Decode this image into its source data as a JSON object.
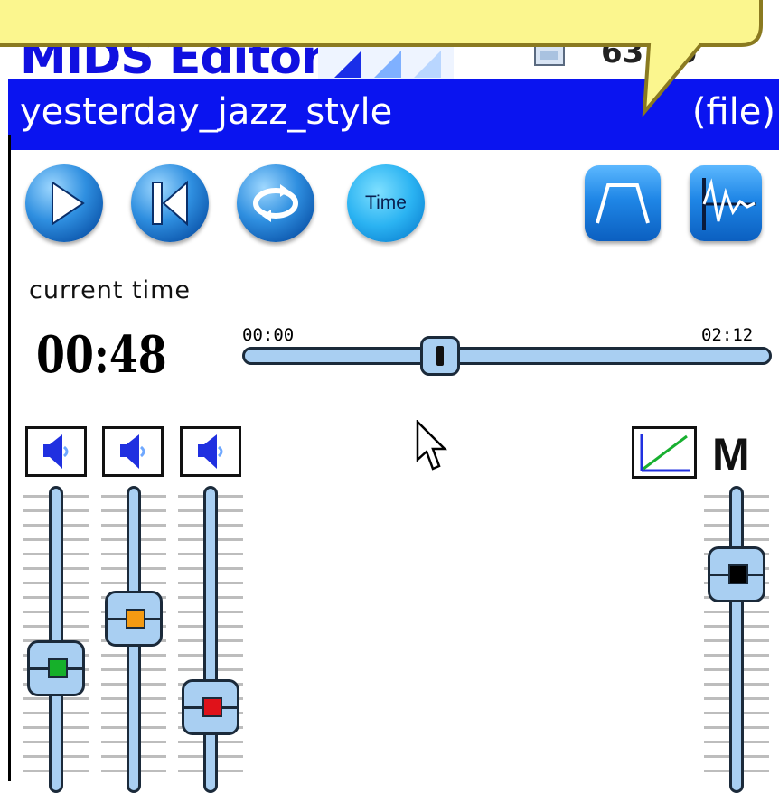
{
  "app": {
    "title": "MIDS Editor",
    "memory": "63 kb"
  },
  "file_bar": {
    "song_name": "yesterday_jazz_style",
    "file_menu_label": "(file)"
  },
  "toolbar": {
    "play_icon": "play-icon",
    "rewind_icon": "skip-to-start-icon",
    "loop_icon": "loop-icon",
    "time_button_label": "Time",
    "envelope_icon": "envelope-icon",
    "waveform_icon": "waveform-icon"
  },
  "playback": {
    "current_time_label": "current time",
    "current_time_value": "00:48",
    "start_time": "00:00",
    "end_time": "02:12",
    "position_fraction": 0.364
  },
  "mixer": {
    "tracks": [
      {
        "led_color": "#16b02a",
        "level": 0.44
      },
      {
        "led_color": "#f49a12",
        "level": 0.62
      },
      {
        "led_color": "#e0121a",
        "level": 0.3
      }
    ],
    "master_label": "M",
    "master_level": 0.78,
    "master_led_color": "#000000"
  },
  "colors": {
    "file_bar": "#0a14f0",
    "tooltip": "#fbf68e",
    "fader": "#a9cff2"
  }
}
